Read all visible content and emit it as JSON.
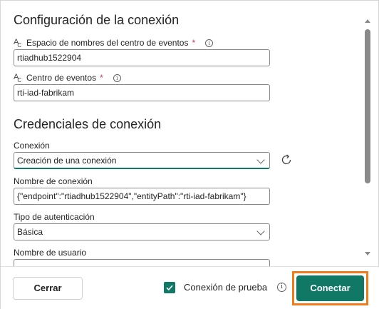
{
  "connection_settings": {
    "title": "Configuración de la conexión",
    "namespace_label": "Espacio de nombres del centro de eventos",
    "namespace_value": "rtiadhub1522904",
    "eventhub_label": "Centro de eventos",
    "eventhub_value": "rti-iad-fabrikam",
    "required_mark": "*",
    "info_glyph": "i"
  },
  "credentials": {
    "title": "Credenciales de conexión",
    "connection_label": "Conexión",
    "connection_value": "Creación de una conexión",
    "connection_name_label": "Nombre de conexión",
    "connection_name_value": "{\"endpoint\":\"rtiadhub1522904\",\"entityPath\":\"rti-iad-fabrikam\"}",
    "auth_type_label": "Tipo de autenticación",
    "auth_type_value": "Básica",
    "username_label": "Nombre de usuario"
  },
  "footer": {
    "close_label": "Cerrar",
    "test_connection_label": "Conexión de prueba",
    "test_connection_checked": true,
    "connect_label": "Conectar"
  },
  "colors": {
    "accent": "#117865",
    "highlight": "#f07b1a",
    "required": "#c4314b"
  },
  "icons": {
    "field_type": "abc-text-icon",
    "info": "info-icon",
    "refresh": "refresh-icon",
    "dropdown": "chevron-down-icon",
    "check": "checkmark-icon"
  }
}
